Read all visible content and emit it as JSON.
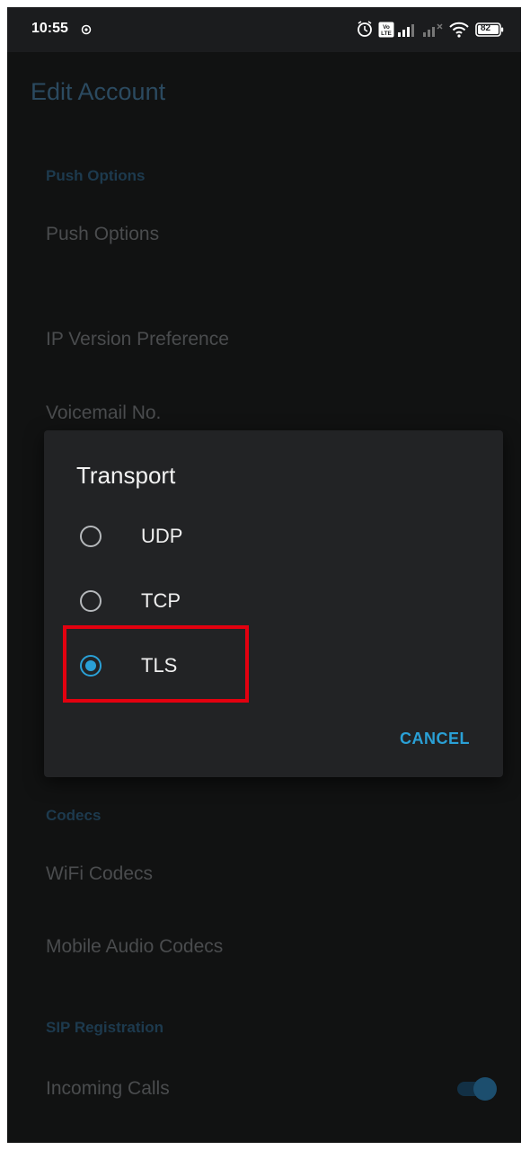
{
  "status_bar": {
    "time": "10:55",
    "battery": "82",
    "icons": [
      "notification-dot-icon",
      "alarm-icon",
      "volte-icon",
      "signal-icon",
      "signal-no-service-icon",
      "wifi-icon",
      "battery-icon"
    ]
  },
  "settings": {
    "title": "Edit Account",
    "sections": {
      "push_header": "Push Options",
      "push_options": "Push Options",
      "ip_version": "IP Version Preference",
      "voicemail": "Voicemail No.",
      "codecs_header": "Codecs",
      "wifi_codecs": "WiFi Codecs",
      "mobile_codecs": "Mobile Audio Codecs",
      "sip_header": "SIP Registration",
      "incoming_calls": "Incoming Calls"
    },
    "incoming_calls_enabled": true
  },
  "dialog": {
    "title": "Transport",
    "options": [
      {
        "label": "UDP",
        "checked": false
      },
      {
        "label": "TCP",
        "checked": false
      },
      {
        "label": "TLS",
        "checked": true
      }
    ],
    "cancel_label": "CANCEL"
  },
  "colors": {
    "accent": "#2aa0d6",
    "highlight": "#e3000f",
    "background": "#111212",
    "dialog": "#222325"
  }
}
